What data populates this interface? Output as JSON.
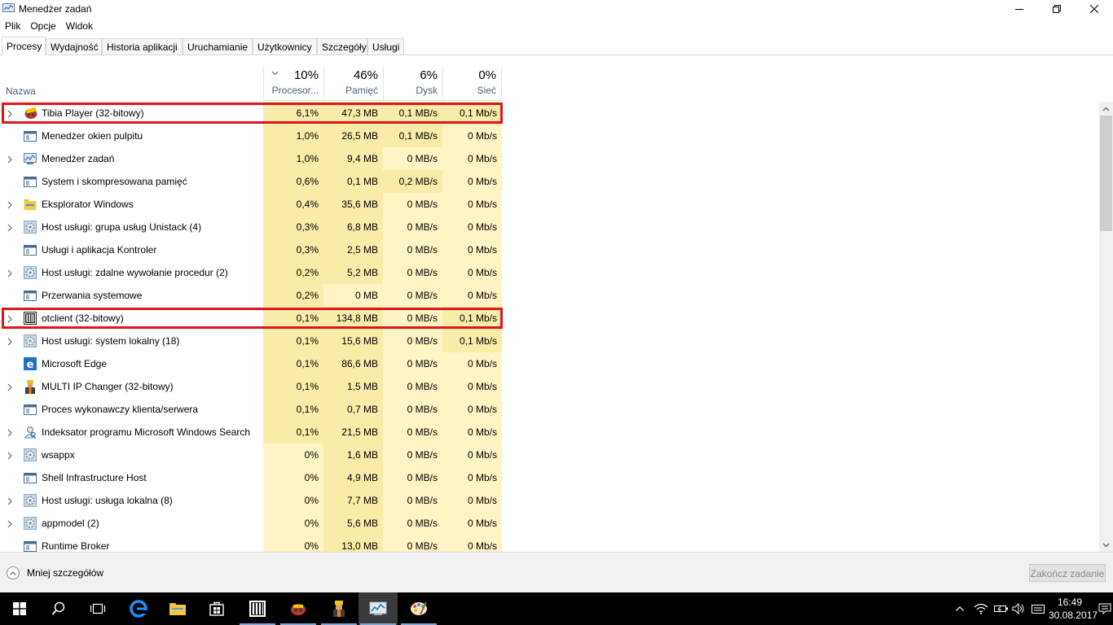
{
  "window": {
    "title": "Menedżer zadań"
  },
  "menu": [
    "Plik",
    "Opcje",
    "Widok"
  ],
  "tabs": [
    "Procesy",
    "Wydajność",
    "Historia aplikacji",
    "Uruchamianie",
    "Użytkownicy",
    "Szczegóły",
    "Usługi"
  ],
  "columns": {
    "name": "Nazwa",
    "cpu": {
      "pct": "10%",
      "label": "Procesor..."
    },
    "mem": {
      "pct": "46%",
      "label": "Pamięć"
    },
    "disk": {
      "pct": "6%",
      "label": "Dysk"
    },
    "net": {
      "pct": "0%",
      "label": "Sieć"
    }
  },
  "processes": [
    {
      "name": "Tibia Player (32-bitowy)",
      "cpu": "6,1%",
      "mem": "47,3 MB",
      "disk": "0,1 MB/s",
      "net": "0,1 Mb/s",
      "expandable": true,
      "icon": "tibia-icon",
      "highlighted": true
    },
    {
      "name": "Menedżer okien pulpitu",
      "cpu": "1,0%",
      "mem": "26,5 MB",
      "disk": "0,1 MB/s",
      "net": "0 Mb/s",
      "expandable": false,
      "icon": "window-icon"
    },
    {
      "name": "Menedżer zadań",
      "cpu": "1,0%",
      "mem": "9,4 MB",
      "disk": "0 MB/s",
      "net": "0 Mb/s",
      "expandable": true,
      "icon": "task-manager-icon"
    },
    {
      "name": "System i skompresowana pamięć",
      "cpu": "0,6%",
      "mem": "0,1 MB",
      "disk": "0,2 MB/s",
      "net": "0 Mb/s",
      "expandable": false,
      "icon": "window-icon"
    },
    {
      "name": "Eksplorator Windows",
      "cpu": "0,4%",
      "mem": "35,6 MB",
      "disk": "0 MB/s",
      "net": "0 Mb/s",
      "expandable": true,
      "icon": "folder-icon"
    },
    {
      "name": "Host usługi: grupa usług Unistack (4)",
      "cpu": "0,3%",
      "mem": "6,8 MB",
      "disk": "0 MB/s",
      "net": "0 Mb/s",
      "expandable": true,
      "icon": "gear-icon"
    },
    {
      "name": "Usługi i aplikacja Kontroler",
      "cpu": "0,3%",
      "mem": "2,5 MB",
      "disk": "0 MB/s",
      "net": "0 Mb/s",
      "expandable": false,
      "icon": "window-icon"
    },
    {
      "name": "Host usługi: zdalne wywołanie procedur (2)",
      "cpu": "0,2%",
      "mem": "5,2 MB",
      "disk": "0 MB/s",
      "net": "0 Mb/s",
      "expandable": true,
      "icon": "gear-icon"
    },
    {
      "name": "Przerwania systemowe",
      "cpu": "0,2%",
      "mem": "0 MB",
      "disk": "0 MB/s",
      "net": "0 Mb/s",
      "expandable": false,
      "icon": "window-icon"
    },
    {
      "name": "otclient (32-bitowy)",
      "cpu": "0,1%",
      "mem": "134,8 MB",
      "disk": "0 MB/s",
      "net": "0,1 Mb/s",
      "expandable": true,
      "icon": "otclient-icon",
      "highlighted": true
    },
    {
      "name": "Host usługi: system lokalny (18)",
      "cpu": "0,1%",
      "mem": "15,6 MB",
      "disk": "0 MB/s",
      "net": "0,1 Mb/s",
      "expandable": true,
      "icon": "gear-icon"
    },
    {
      "name": "Microsoft Edge",
      "cpu": "0,1%",
      "mem": "86,6 MB",
      "disk": "0 MB/s",
      "net": "0 Mb/s",
      "expandable": false,
      "icon": "edge-icon"
    },
    {
      "name": "MULTI IP Changer (32-bitowy)",
      "cpu": "0,1%",
      "mem": "1,5 MB",
      "disk": "0 MB/s",
      "net": "0 Mb/s",
      "expandable": true,
      "icon": "ip-changer-icon"
    },
    {
      "name": "Proces wykonawczy klienta/serwera",
      "cpu": "0,1%",
      "mem": "0,7 MB",
      "disk": "0 MB/s",
      "net": "0 Mb/s",
      "expandable": false,
      "icon": "window-icon"
    },
    {
      "name": "Indeksator programu Microsoft Windows Search",
      "cpu": "0,1%",
      "mem": "21,5 MB",
      "disk": "0 MB/s",
      "net": "0 Mb/s",
      "expandable": true,
      "icon": "search-indexer-icon"
    },
    {
      "name": "wsappx",
      "cpu": "0%",
      "mem": "1,6 MB",
      "disk": "0 MB/s",
      "net": "0 Mb/s",
      "expandable": true,
      "icon": "gear-icon"
    },
    {
      "name": "Shell Infrastructure Host",
      "cpu": "0%",
      "mem": "4,9 MB",
      "disk": "0 MB/s",
      "net": "0 Mb/s",
      "expandable": false,
      "icon": "window-icon"
    },
    {
      "name": "Host usługi: usługa lokalna (8)",
      "cpu": "0%",
      "mem": "7,7 MB",
      "disk": "0 MB/s",
      "net": "0 Mb/s",
      "expandable": true,
      "icon": "gear-icon"
    },
    {
      "name": "appmodel (2)",
      "cpu": "0%",
      "mem": "5,6 MB",
      "disk": "0 MB/s",
      "net": "0 Mb/s",
      "expandable": true,
      "icon": "gear-icon"
    },
    {
      "name": "Runtime Broker",
      "cpu": "0%",
      "mem": "13,0 MB",
      "disk": "0 MB/s",
      "net": "0 Mb/s",
      "expandable": false,
      "icon": "window-icon"
    }
  ],
  "footer": {
    "less_details": "Mniej szczegółów",
    "end_task": "Zakończ zadanie"
  },
  "clock": {
    "time": "16:49",
    "date": "30.08.2017"
  },
  "colors": {
    "heat_light": "#fff4c4",
    "heat_medium": "#f9eca8",
    "highlight_border": "#e0151b",
    "header_text": "#4c607a"
  }
}
